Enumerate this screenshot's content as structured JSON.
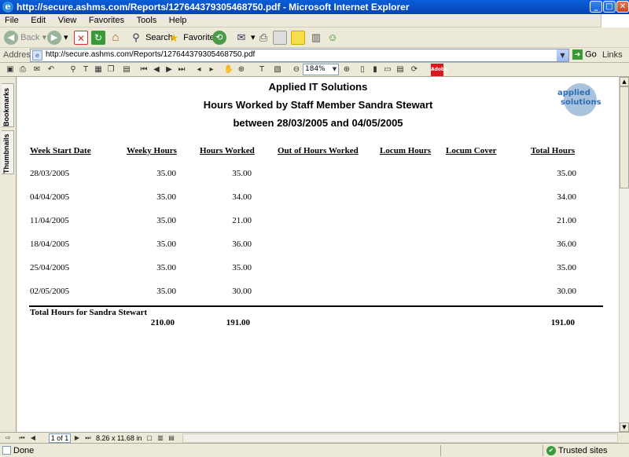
{
  "window": {
    "title": "http://secure.ashms.com/Reports/127644379305468750.pdf - Microsoft Internet Explorer",
    "minimize": "_",
    "maximize": "□",
    "close": "✕"
  },
  "menu": [
    "File",
    "Edit",
    "View",
    "Favorites",
    "Tools",
    "Help"
  ],
  "toolbar": {
    "back": "Back",
    "search": "Search",
    "favorites": "Favorites"
  },
  "address": {
    "label": "Address",
    "url": "http://secure.ashms.com/Reports/127644379305468750.pdf",
    "go": "Go",
    "links": "Links"
  },
  "acrobat": {
    "zoom": "184%"
  },
  "sidetabs": [
    "Bookmarks",
    "Thumbnails"
  ],
  "report": {
    "company": "Applied IT Solutions",
    "title": "Hours Worked by Staff Member Sandra Stewart",
    "range": "between 28/03/2005 and 04/05/2005",
    "logo_line1": "applied",
    "logo_line2": "solutions",
    "columns": [
      "Week Start Date",
      "Weeky Hours",
      "Hours Worked",
      "Out of Hours Worked",
      "Locum Hours",
      "Locum Cover",
      "Total Hours"
    ],
    "rows": [
      {
        "week": "28/03/2005",
        "weekly": "35.00",
        "worked": "35.00",
        "total": "35.00"
      },
      {
        "week": "04/04/2005",
        "weekly": "35.00",
        "worked": "34.00",
        "total": "34.00"
      },
      {
        "week": "11/04/2005",
        "weekly": "35.00",
        "worked": "21.00",
        "total": "21.00"
      },
      {
        "week": "18/04/2005",
        "weekly": "35.00",
        "worked": "36.00",
        "total": "36.00"
      },
      {
        "week": "25/04/2005",
        "weekly": "35.00",
        "worked": "35.00",
        "total": "35.00"
      },
      {
        "week": "02/05/2005",
        "weekly": "35.00",
        "worked": "30.00",
        "total": "30.00"
      }
    ],
    "totals_label": "Total Hours for Sandra Stewart",
    "totals": {
      "weekly": "210.00",
      "worked": "191.00",
      "total": "191.00"
    }
  },
  "pdfnav": {
    "page": "1 of 1",
    "size": "8.26 x 11.68 in"
  },
  "status": {
    "text": "Done",
    "zone": "Trusted sites"
  }
}
